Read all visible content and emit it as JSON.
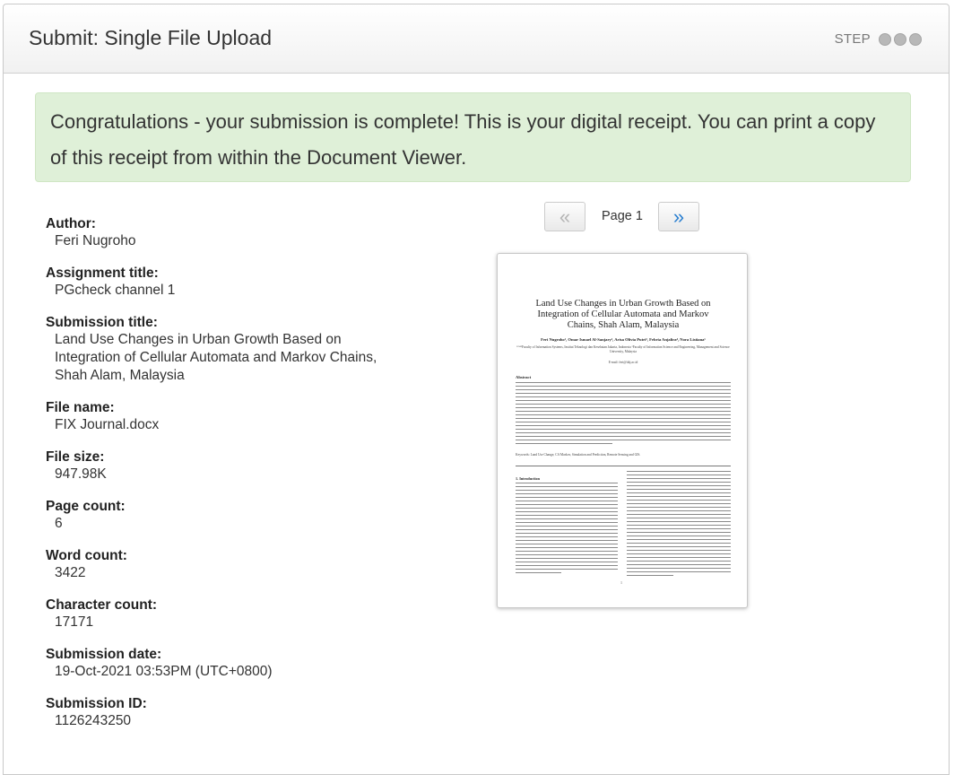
{
  "header": {
    "title": "Submit: Single File Upload",
    "step_label": "STEP"
  },
  "alert": {
    "message": "Congratulations - your submission is complete! This is your digital receipt. You can print a copy of this receipt from within the Document Viewer."
  },
  "receipt": [
    {
      "label": "Author:",
      "value": "Feri Nugroho"
    },
    {
      "label": "Assignment title:",
      "value": "PGcheck channel 1"
    },
    {
      "label": "Submission title:",
      "value": "Land Use Changes in Urban Growth Based on Integration of Cellular Automata and Markov Chains, Shah Alam, Malaysia"
    },
    {
      "label": "File name:",
      "value": "FIX Journal.docx"
    },
    {
      "label": "File size:",
      "value": "947.98K"
    },
    {
      "label": "Page count:",
      "value": "6"
    },
    {
      "label": "Word count:",
      "value": "3422"
    },
    {
      "label": "Character count:",
      "value": "17171"
    },
    {
      "label": "Submission date:",
      "value": "19-Oct-2021 03:53PM (UTC+0800)"
    },
    {
      "label": "Submission ID:",
      "value": "1126243250"
    }
  ],
  "pager": {
    "prev_icon": "«",
    "next_icon": "»",
    "page_label": "Page 1"
  },
  "document_preview": {
    "title": "Land Use Changes in Urban Growth Based on Integration of Cellular Automata and Markov Chains, Shah Alam, Malaysia",
    "authors": "Feri Nugroho¹, Omar Ismael Al-Sanjary², Arisa Olivia Putri³, Febria Anjalira⁴, Nora Listiana⁵",
    "affiliation": "¹²³⁴⁵Faculty of Information Systems, Institut Teknologi dan Kesehatan Jakarta, Indonesia ²Faculty of Information Science and Engineering, Management and Science University, Malaysia",
    "email": "E-mail: feri@itkj.ac.id",
    "abstract_heading": "Abstract",
    "keywords": "Keywords: Land Use Change, CA Markov, Simulation and Prediction, Remote Sensing and GIS.",
    "intro_heading": "1. Introduction",
    "page_number": "1"
  },
  "colors": {
    "alert_bg": "#dff0d8",
    "next_arrow": "#2a7fd0",
    "prev_arrow": "#b5b5b5",
    "step_dot": "#b8b8b8"
  }
}
